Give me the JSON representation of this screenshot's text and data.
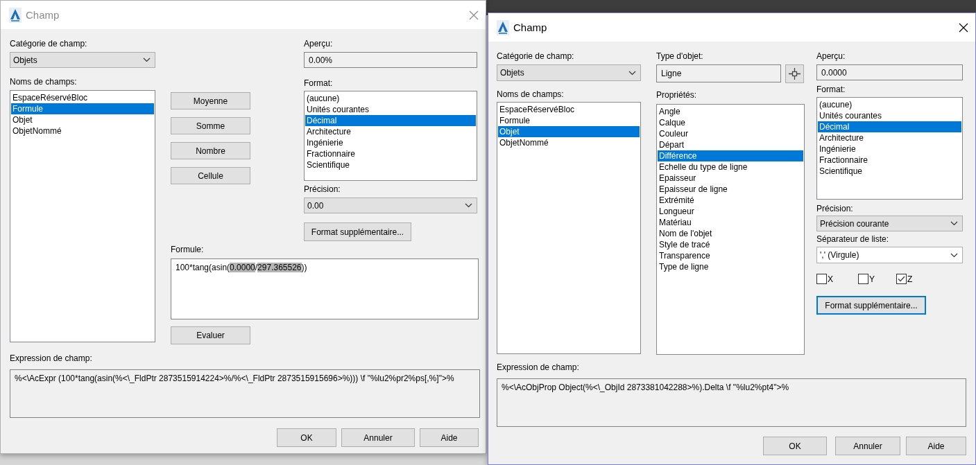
{
  "formula_dialog": {
    "title": "Champ",
    "category": {
      "label": "Catégorie de champ:",
      "value": "Objets"
    },
    "field_names": {
      "label": "Noms de champs:",
      "items": [
        {
          "label": "EspaceRéservéBloc",
          "selected": false
        },
        {
          "label": "Formule",
          "selected": true
        },
        {
          "label": "Objet",
          "selected": false
        },
        {
          "label": "ObjetNommé",
          "selected": false
        }
      ]
    },
    "function_buttons": [
      "Moyenne",
      "Somme",
      "Nombre",
      "Cellule"
    ],
    "preview": {
      "label": "Aperçu:",
      "value": "0.00%"
    },
    "format": {
      "label": "Format:",
      "items": [
        {
          "label": "(aucune)",
          "selected": false
        },
        {
          "label": "Unités courantes",
          "selected": false
        },
        {
          "label": "Décimal",
          "selected": true
        },
        {
          "label": "Architecture",
          "selected": false
        },
        {
          "label": "Ingénierie",
          "selected": false
        },
        {
          "label": "Fractionnaire",
          "selected": false
        },
        {
          "label": "Scientifique",
          "selected": false
        }
      ]
    },
    "precision": {
      "label": "Précision:",
      "value": "0.00"
    },
    "additional_format_button": "Format supplémentaire...",
    "formula": {
      "label": "Formule:",
      "segments": [
        {
          "text": "100*tang(asin(",
          "highlighted": false
        },
        {
          "text": "0.0000",
          "highlighted": true
        },
        {
          "text": "/",
          "highlighted": false
        },
        {
          "text": "297.365526",
          "highlighted": true
        },
        {
          "text": "))",
          "highlighted": false
        }
      ]
    },
    "evaluate_button": "Evaluer",
    "expression": {
      "label": "Expression de champ:",
      "value": "%<\\AcExpr (100*tang(asin(%<\\_FldPtr 2873515914224>%/%<\\_FldPtr 2873515915696>%))) \\f \"%lu2%pr2%ps[,%]\">%"
    },
    "buttons": [
      "OK",
      "Annuler",
      "Aide"
    ]
  },
  "object_dialog": {
    "title": "Champ",
    "category": {
      "label": "Catégorie de champ:",
      "value": "Objets"
    },
    "field_names": {
      "label": "Noms de champs:",
      "items": [
        {
          "label": "EspaceRéservéBloc",
          "selected": false
        },
        {
          "label": "Formule",
          "selected": false
        },
        {
          "label": "Objet",
          "selected": true
        },
        {
          "label": "ObjetNommé",
          "selected": false
        }
      ]
    },
    "object_type": {
      "label": "Type d'objet:",
      "value": "Ligne"
    },
    "properties": {
      "label": "Propriétés:",
      "items": [
        {
          "label": "Angle",
          "selected": false
        },
        {
          "label": "Calque",
          "selected": false
        },
        {
          "label": "Couleur",
          "selected": false
        },
        {
          "label": "Départ",
          "selected": false
        },
        {
          "label": "Différence",
          "selected": true
        },
        {
          "label": "Echelle du type de ligne",
          "selected": false
        },
        {
          "label": "Epaisseur",
          "selected": false
        },
        {
          "label": "Epaisseur de ligne",
          "selected": false
        },
        {
          "label": "Extrémité",
          "selected": false
        },
        {
          "label": "Longueur",
          "selected": false
        },
        {
          "label": "Matériau",
          "selected": false
        },
        {
          "label": "Nom de l'objet",
          "selected": false
        },
        {
          "label": "Style de tracé",
          "selected": false
        },
        {
          "label": "Transparence",
          "selected": false
        },
        {
          "label": "Type de ligne",
          "selected": false
        }
      ]
    },
    "preview": {
      "label": "Aperçu:",
      "value": "0.0000"
    },
    "format": {
      "label": "Format:",
      "items": [
        {
          "label": "(aucune)",
          "selected": false
        },
        {
          "label": "Unités courantes",
          "selected": false
        },
        {
          "label": "Décimal",
          "selected": true
        },
        {
          "label": "Architecture",
          "selected": false
        },
        {
          "label": "Ingénierie",
          "selected": false
        },
        {
          "label": "Fractionnaire",
          "selected": false
        },
        {
          "label": "Scientifique",
          "selected": false
        }
      ]
    },
    "precision": {
      "label": "Précision:",
      "value": "Précision courante"
    },
    "list_separator": {
      "label": "Séparateur de liste:",
      "value": "',' (Virgule)"
    },
    "axes": [
      {
        "label": "X",
        "checked": false
      },
      {
        "label": "Y",
        "checked": false
      },
      {
        "label": "Z",
        "checked": true
      }
    ],
    "additional_format_button": "Format supplémentaire...",
    "expression": {
      "label": "Expression de champ:",
      "value": "%<\\AcObjProp Object(%<\\_ObjId 2873381042288>%).Delta \\f \"%lu2%pt4\">%"
    },
    "buttons": [
      "OK",
      "Annuler",
      "Aide"
    ]
  }
}
